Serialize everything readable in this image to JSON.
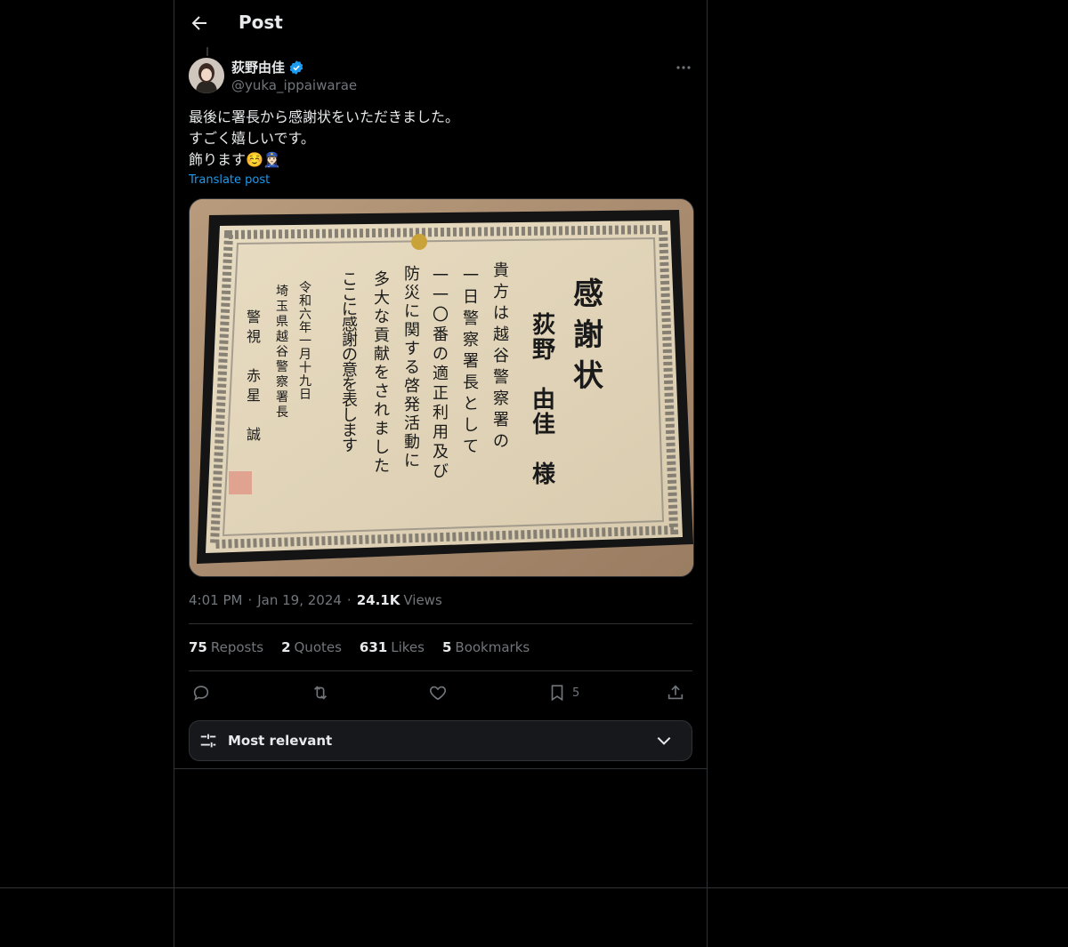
{
  "header": {
    "title": "Post"
  },
  "post": {
    "author_name": "荻野由佳",
    "author_handle": "@yuka_ippaiwarae",
    "lines": [
      "最後に署長から感謝状をいただきました。",
      "すごく嬉しいです。",
      "飾ります☺️👮🏻‍♀️"
    ],
    "translate_label": "Translate post",
    "time": "4:01 PM",
    "date": "Jan 19, 2024",
    "views_count": "24.1K",
    "views_label": "Views",
    "dot": "·"
  },
  "media": {
    "certificate_title": "感謝状",
    "recipient": "荻野 由佳 様",
    "body_lines": [
      "貴方は越谷警察署の",
      "一日警察署長として",
      "一一〇番の適正利用及び",
      "防災に関する啓発活動に",
      "多大な貢献をされました",
      "ここに感謝の意を表します"
    ],
    "date_line": "令和六年一月十九日",
    "issuer_line": "埼玉県越谷警察署長",
    "signer_line": "警視 赤星 誠"
  },
  "stats": [
    {
      "num": "75",
      "label": "Reposts"
    },
    {
      "num": "2",
      "label": "Quotes"
    },
    {
      "num": "631",
      "label": "Likes"
    },
    {
      "num": "5",
      "label": "Bookmarks"
    }
  ],
  "actions": {
    "bookmark_count": "5"
  },
  "sort": {
    "label": "Most relevant"
  },
  "colors": {
    "accent": "#1d9bf0",
    "muted": "#71767b",
    "border": "#2f3336"
  }
}
